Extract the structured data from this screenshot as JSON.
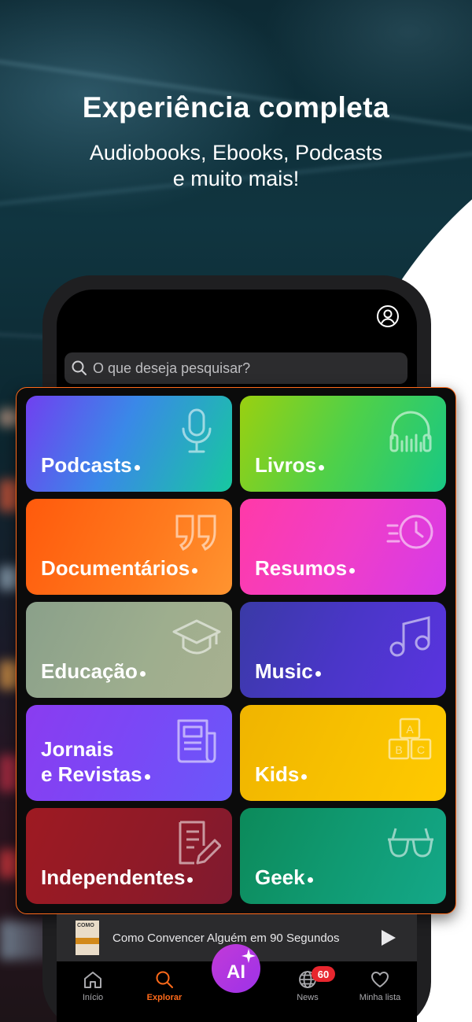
{
  "promo": {
    "title": "Experiência completa",
    "subtitle_line1": "Audiobooks, Ebooks, Podcasts",
    "subtitle_line2": "e muito mais!"
  },
  "search": {
    "placeholder": "O que deseja pesquisar?"
  },
  "categories": [
    {
      "label": "Podcasts",
      "icon": "microphone-icon"
    },
    {
      "label": "Livros",
      "icon": "headphones-icon"
    },
    {
      "label": "Documentários",
      "icon": "quote-icon"
    },
    {
      "label": "Resumos",
      "icon": "fast-clock-icon"
    },
    {
      "label": "Educação",
      "icon": "graduation-cap-icon"
    },
    {
      "label": "Music",
      "icon": "music-note-icon"
    },
    {
      "label_line1": "Jornais",
      "label_line2": "e Revistas",
      "icon": "newspaper-icon"
    },
    {
      "label": "Kids",
      "icon": "abc-blocks-icon"
    },
    {
      "label": "Independentes",
      "icon": "document-edit-icon"
    },
    {
      "label": "Geek",
      "icon": "glasses-icon"
    }
  ],
  "player": {
    "title": "Como Convencer Alguém em 90 Segundos",
    "cover_text": "COMO"
  },
  "nav": {
    "home": "Início",
    "explore": "Explorar",
    "ai": "AI",
    "news": "News",
    "news_badge": "60",
    "wishlist": "Minha lista",
    "active": "Explorar"
  },
  "colors": {
    "accent": "#ff6a1a",
    "badge": "#e8262e",
    "ai_button": "#b236e0"
  }
}
